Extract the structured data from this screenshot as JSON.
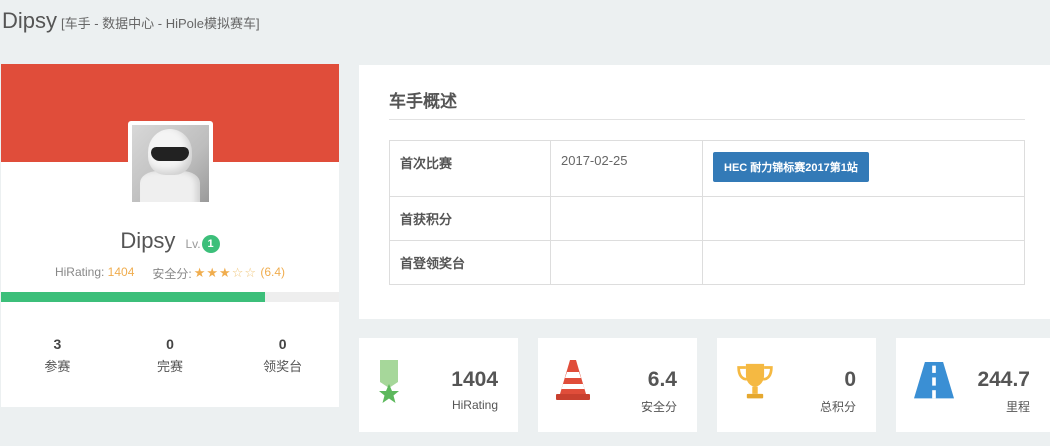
{
  "header": {
    "title": "Dipsy",
    "subtitle": "[车手 - 数据中心 - HiPole模拟赛车]"
  },
  "profile": {
    "name": "Dipsy",
    "level_label": "Lv.",
    "level": "1",
    "hirating_label": "HiRating:",
    "hirating_value": "1404",
    "safety_label": "安全分:",
    "safety_value": "(6.4)",
    "stars_filled": "★★★",
    "stars_empty": "☆☆",
    "progress": 0.78,
    "stats": [
      {
        "value": "3",
        "label": "参赛"
      },
      {
        "value": "0",
        "label": "完赛"
      },
      {
        "value": "0",
        "label": "领奖台"
      }
    ]
  },
  "overview": {
    "title": "车手概述",
    "rows": [
      {
        "label": "首次比赛",
        "date": "2017-02-25",
        "event": "HEC 耐力锦标赛2017第1站"
      },
      {
        "label": "首获积分",
        "date": "",
        "event": ""
      },
      {
        "label": "首登领奖台",
        "date": "",
        "event": ""
      }
    ]
  },
  "cards": [
    {
      "icon": "ribbon-star-icon",
      "value": "1404",
      "label": "HiRating",
      "color": "#7ec472"
    },
    {
      "icon": "traffic-cone-icon",
      "value": "6.4",
      "label": "安全分",
      "color": "#e04d3a"
    },
    {
      "icon": "trophy-icon",
      "value": "0",
      "label": "总积分",
      "color": "#f5b942"
    },
    {
      "icon": "road-icon",
      "value": "244.7",
      "label": "里程",
      "color": "#3a8fd4"
    }
  ],
  "colors": {
    "banner": "#e04d3a",
    "accent_green": "#3cbf7a",
    "tag_blue": "#337ab7",
    "rating_orange": "#f0ad4e"
  }
}
